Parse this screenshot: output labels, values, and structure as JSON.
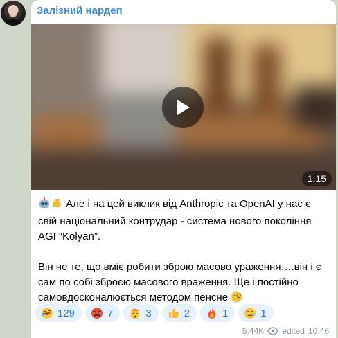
{
  "channel": {
    "name": "Залізний нардеп"
  },
  "video": {
    "duration": "1:15"
  },
  "post": {
    "line1": "Але і на цей виклик від Anthropic та OpenAI у нас є свій національний контрудар - система нового покоління AGI “Kolyan”.",
    "line2": "Він не те, що вміє робити зброю масово ураження….він і є сам по собі зброєю масового враження. Ще і постійно самовдосконалюється методом пенсне"
  },
  "reactions": [
    {
      "icon": "rofl-emoji-icon",
      "count": "129"
    },
    {
      "icon": "angry-face-emoji-icon",
      "count": "7"
    },
    {
      "icon": "exploding-head-emoji-icon",
      "count": "3"
    },
    {
      "icon": "thumbs-up-emoji-icon",
      "count": "2"
    },
    {
      "icon": "fire-emoji-icon",
      "count": "1"
    },
    {
      "icon": "crying-face-emoji-icon",
      "count": "1"
    }
  ],
  "meta": {
    "views": "5.44K",
    "status": "edited",
    "time": "10:46"
  }
}
